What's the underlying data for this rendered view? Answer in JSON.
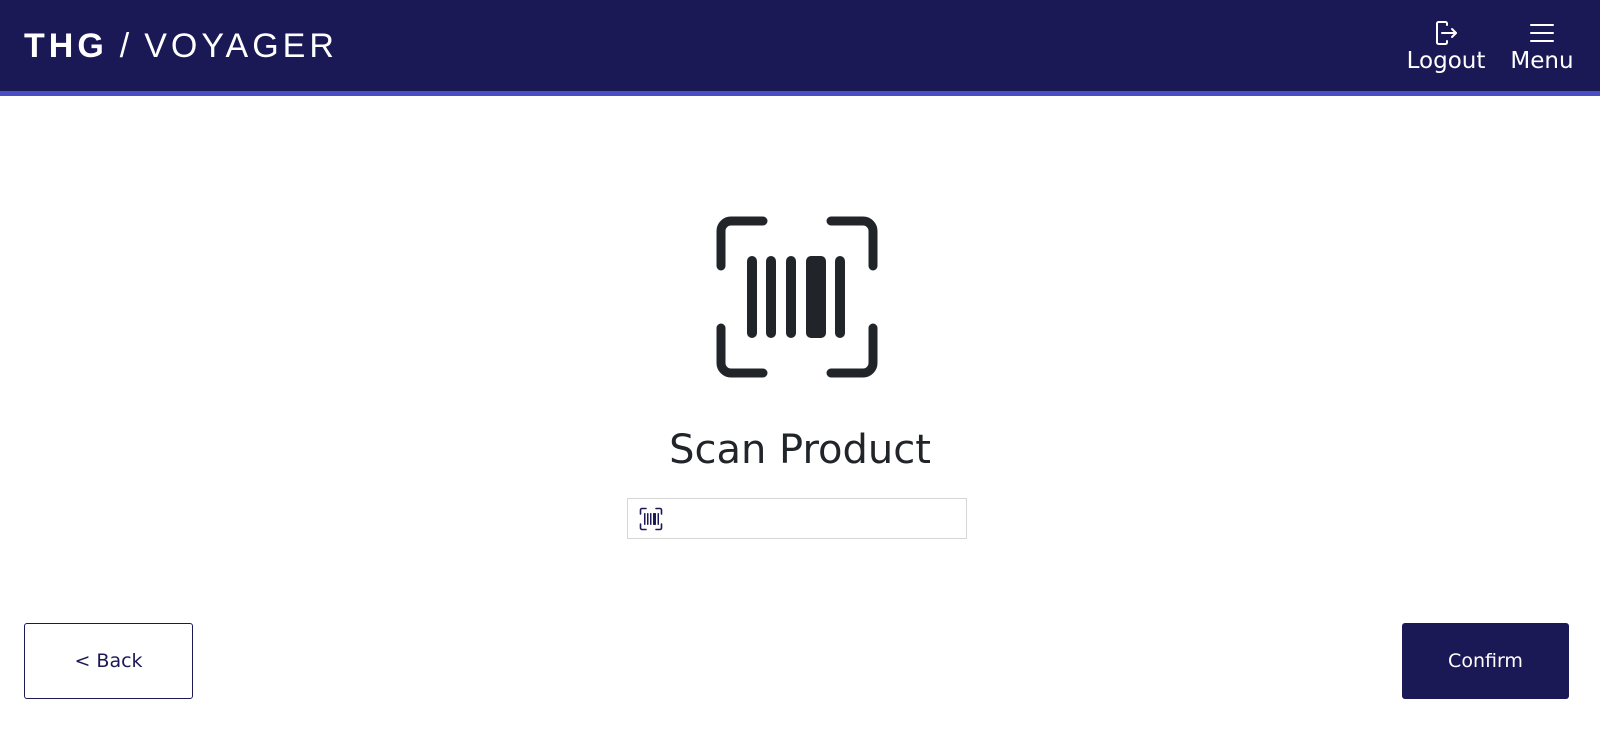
{
  "header": {
    "logo": {
      "brand": "THG",
      "separator": "/",
      "product": "VOYAGER"
    },
    "logout_label": "Logout",
    "menu_label": "Menu",
    "logout_icon": "logout-icon",
    "menu_icon": "hamburger-menu-icon"
  },
  "main": {
    "hero_icon": "barcode-scan-icon",
    "title": "Scan Product",
    "scan_input": {
      "value": "",
      "placeholder": "",
      "icon": "barcode-scan-icon"
    }
  },
  "footer": {
    "back_label": "< Back",
    "confirm_label": "Confirm"
  },
  "colors": {
    "header_bg": "#1b1856",
    "header_accent": "#4b4fc4",
    "primary": "#1b1856",
    "text": "#212529"
  }
}
